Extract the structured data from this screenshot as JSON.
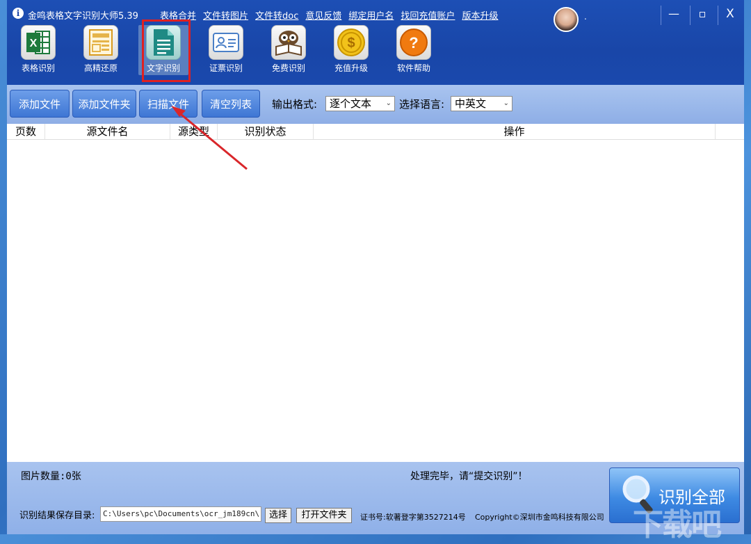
{
  "app": {
    "title": "金鸣表格文字识别大师5.39",
    "logo_icon": "app-logo-icon",
    "logo_glyph": "i"
  },
  "menu": [
    "表格合并",
    "文件转图片",
    "文件转doc",
    "意见反馈",
    "绑定用户名",
    "找回充值账户",
    "版本升级"
  ],
  "user": {
    "name": "."
  },
  "window_controls": {
    "minimize": "—",
    "maximize": "▫",
    "close": "X"
  },
  "tools": [
    {
      "label": "表格识别",
      "icon": "excel-icon"
    },
    {
      "label": "高精还原",
      "icon": "layout-restore-icon"
    },
    {
      "label": "文字识别",
      "icon": "document-text-icon"
    },
    {
      "label": "证票识别",
      "icon": "id-card-icon"
    },
    {
      "label": "免费识别",
      "icon": "reading-owl-icon"
    },
    {
      "label": "充值升级",
      "icon": "coin-dollar-icon"
    },
    {
      "label": "软件帮助",
      "icon": "help-question-icon"
    }
  ],
  "toolbar": {
    "add_file": "添加文件",
    "add_folder": "添加文件夹",
    "scan_file": "扫描文件",
    "clear_list": "清空列表",
    "output_format_label": "输出格式:",
    "output_format_value": "逐个文本",
    "language_label": "选择语言:",
    "language_value": "中英文"
  },
  "table": {
    "columns": [
      "页数",
      "源文件名",
      "源类型",
      "识别状态",
      "操作"
    ]
  },
  "bottom": {
    "image_count": "图片数量:0张",
    "status": "处理完毕，请“提交识别”！",
    "save_dir_label": "识别结果保存目录:",
    "save_dir_value": "C:\\Users\\pc\\Documents\\ocr_jm189cn\\",
    "choose_button": "选择",
    "open_folder_button": "打开文件夹",
    "cert": "证书号:软著登字第3527214号",
    "copyright": "Copyright©深圳市金鸣科技有限公司",
    "recognize_all": "识别全部"
  },
  "watermark": "下载吧",
  "colors": {
    "title_bar": "#1a44a6",
    "toolbar_bg": "#9ab8ea",
    "button_blue": "#3e76d4",
    "highlight_red": "#e02020",
    "annotation_arrow": "#d9262a"
  }
}
